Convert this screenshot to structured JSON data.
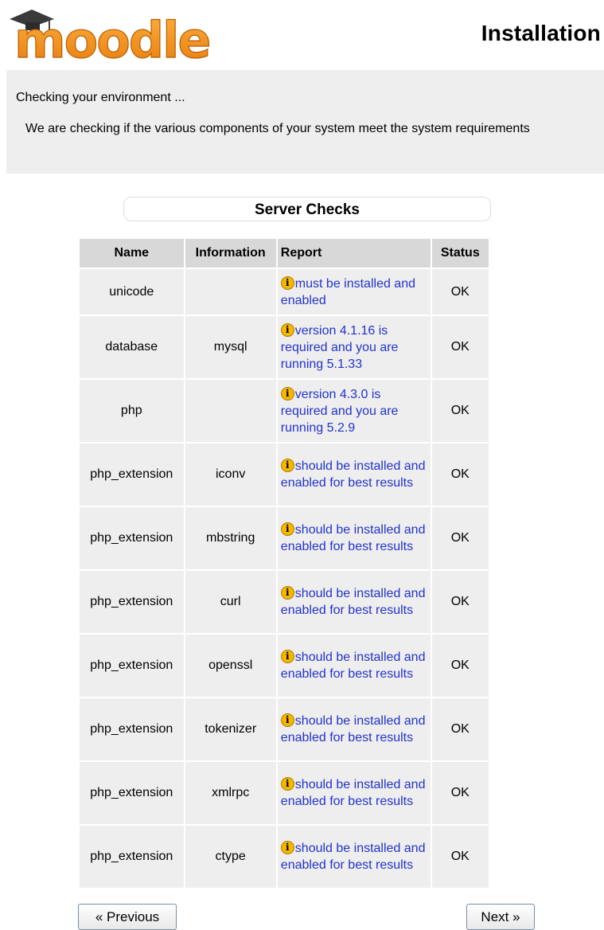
{
  "header": {
    "logo_text": "moodle",
    "title": "Installation"
  },
  "info": {
    "heading": "Checking your environment ...",
    "description": "We are checking if the various components of your system meet the system requirements"
  },
  "section_title": "Server Checks",
  "table": {
    "columns": [
      "Name",
      "Information",
      "Report",
      "Status"
    ],
    "rows": [
      {
        "name": "unicode",
        "information": "",
        "report": "must be installed and enabled",
        "status": "OK"
      },
      {
        "name": "database",
        "information": "mysql",
        "report": "version 4.1.16 is required and you are running 5.1.33",
        "status": "OK"
      },
      {
        "name": "php",
        "information": "",
        "report": "version 4.3.0 is required and you are running 5.2.9",
        "status": "OK"
      },
      {
        "name": "php_extension",
        "information": "iconv",
        "report": "should be installed and enabled for best results",
        "status": "OK"
      },
      {
        "name": "php_extension",
        "information": "mbstring",
        "report": "should be installed and enabled for best results",
        "status": "OK"
      },
      {
        "name": "php_extension",
        "information": "curl",
        "report": "should be installed and enabled for best results",
        "status": "OK"
      },
      {
        "name": "php_extension",
        "information": "openssl",
        "report": "should be installed and enabled for best results",
        "status": "OK"
      },
      {
        "name": "php_extension",
        "information": "tokenizer",
        "report": "should be installed and enabled for best results",
        "status": "OK"
      },
      {
        "name": "php_extension",
        "information": "xmlrpc",
        "report": "should be installed and enabled for best results",
        "status": "OK"
      },
      {
        "name": "php_extension",
        "information": "ctype",
        "report": "should be installed and enabled for best results",
        "status": "OK"
      }
    ]
  },
  "buttons": {
    "previous": "« Previous",
    "next": "Next »"
  },
  "colors": {
    "report_link": "#2222cc",
    "logo_orange": "#f7941d",
    "info_bg": "#eeeeee",
    "header_cell_bg": "#d8d8d8"
  },
  "icons": {
    "warning": "warning-icon",
    "logo_cap": "graduation-cap-icon"
  }
}
